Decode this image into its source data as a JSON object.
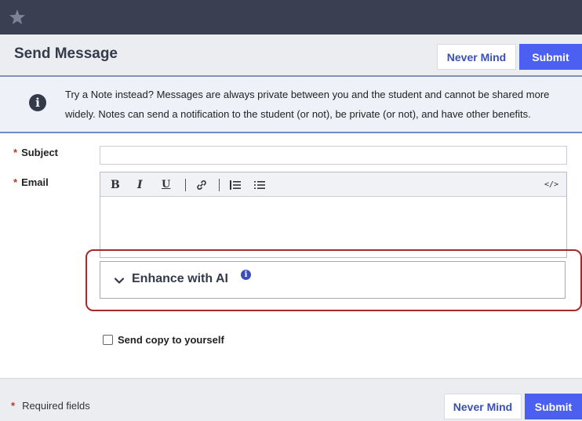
{
  "header": {
    "title": "Send Message",
    "never_mind_label": "Never Mind",
    "submit_label": "Submit"
  },
  "info": {
    "icon": "info-circle-icon",
    "text": "Try a Note instead? Messages are always private between you and the student and cannot be shared more widely. Notes can send a notification to the student (or not), be private (or not), and have other benefits."
  },
  "form": {
    "required_marker": "*",
    "subject_label": "Subject",
    "subject_value": "",
    "email_label": "Email",
    "toolbar": {
      "bold": "B",
      "italic": "I",
      "underline": "U",
      "link_icon": "link-icon",
      "ordered_list_icon": "ordered-list-icon",
      "bullet_list_icon": "bullet-list-icon",
      "code_icon": "code-icon",
      "code_label": "</>"
    },
    "enhance_ai_label": "Enhance with AI",
    "send_copy_label": "Send copy to yourself",
    "send_copy_checked": false
  },
  "footer": {
    "required_marker": "*",
    "required_note": "Required fields",
    "never_mind_label": "Never Mind",
    "submit_label": "Submit"
  },
  "colors": {
    "topbar": "#3a4052",
    "primary_button": "#4b5ff0",
    "required_star": "#b53a27",
    "highlight_outline": "#a52a2a"
  }
}
